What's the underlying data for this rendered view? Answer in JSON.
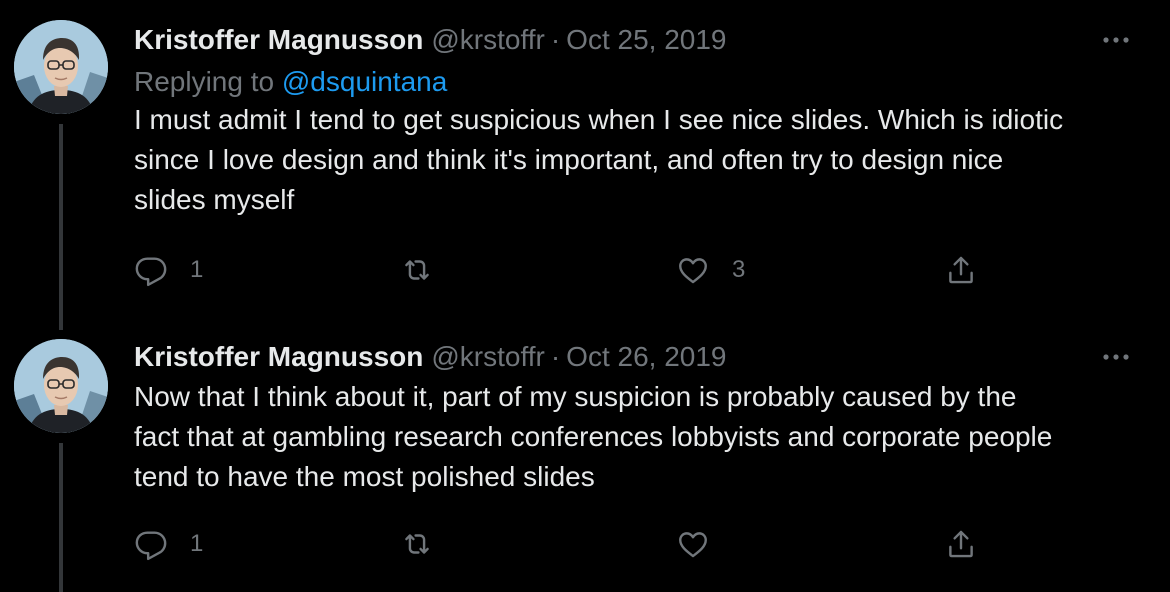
{
  "tweets": [
    {
      "author_name": "Kristoffer Magnusson",
      "handle": "@krstoffr",
      "separator": "·",
      "date": "Oct 25, 2019",
      "reply_prefix": "Replying to",
      "reply_to": "@dsquintana",
      "text_lines": [
        "I must admit I tend to get suspicious when I see nice slides.  Which is idiotic",
        "since I love design and think it's important, and often try to design nice",
        "slides myself"
      ],
      "reply_count": "1",
      "retweet_count": "",
      "like_count": "3"
    },
    {
      "author_name": "Kristoffer Magnusson",
      "handle": "@krstoffr",
      "separator": "·",
      "date": "Oct 26, 2019",
      "text_lines": [
        "Now that I think about it, part of my suspicion is probably caused by the",
        "fact that at gambling research conferences lobbyists and corporate people",
        "tend to have the most polished slides"
      ],
      "reply_count": "1",
      "retweet_count": "",
      "like_count": ""
    }
  ],
  "icons": {
    "more": "more-dots-icon",
    "reply": "reply-bubble-icon",
    "retweet": "retweet-arrows-icon",
    "like": "heart-icon",
    "share": "share-upload-icon"
  },
  "colors": {
    "background": "#000000",
    "primary_text": "#e7e9ea",
    "secondary_text": "#71767b",
    "link": "#1d9bf0",
    "thread_line": "#333639"
  }
}
